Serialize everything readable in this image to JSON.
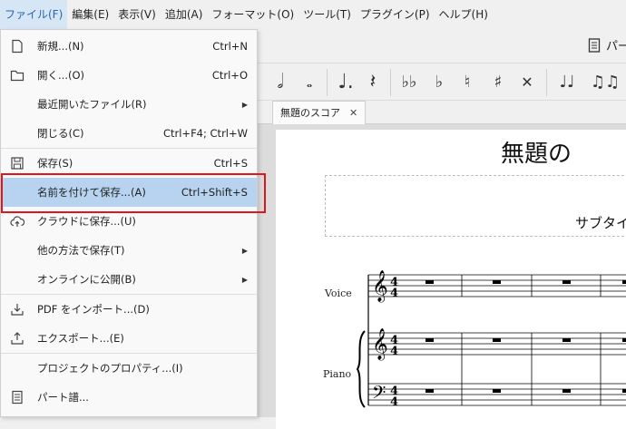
{
  "menubar": {
    "items": [
      "ファイル(F)",
      "編集(E)",
      "表示(V)",
      "追加(A)",
      "フォーマット(O)",
      "ツール(T)",
      "プラグイン(P)",
      "ヘルプ(H)"
    ]
  },
  "toolbar": {
    "parts_label": "パー"
  },
  "tab": {
    "label": "無題のスコア",
    "close": "✕"
  },
  "score": {
    "title": "無題の",
    "subtitle": "サブタイ",
    "instruments": [
      "Voice",
      "Piano"
    ]
  },
  "file_menu": {
    "items": [
      {
        "label": "新規...(N)",
        "shortcut": "Ctrl+N",
        "icon": "new-file-icon"
      },
      {
        "label": "開く...(O)",
        "shortcut": "Ctrl+O",
        "icon": "folder-icon"
      },
      {
        "label": "最近開いたファイル(R)",
        "submenu": true
      },
      {
        "label": "閉じる(C)",
        "shortcut": "Ctrl+F4; Ctrl+W"
      },
      {
        "label": "保存(S)",
        "shortcut": "Ctrl+S",
        "icon": "save-icon"
      },
      {
        "label": "名前を付けて保存...(A)",
        "shortcut": "Ctrl+Shift+S",
        "selected": true
      },
      {
        "label": "クラウドに保存...(U)",
        "icon": "cloud-upload-icon"
      },
      {
        "label": "他の方法で保存(T)",
        "submenu": true
      },
      {
        "label": "オンラインに公開(B)",
        "submenu": true
      },
      {
        "label": "PDF をインポート...(D)",
        "icon": "import-icon"
      },
      {
        "label": "エクスポート...(E)",
        "icon": "export-icon"
      },
      {
        "label": "プロジェクトのプロパティ...(I)"
      },
      {
        "label": "パート譜...",
        "icon": "parts-icon"
      }
    ]
  },
  "colors": {
    "accent": "#2766b3",
    "selected_bg": "#b7d3ef",
    "highlight_border": "#e0161b"
  }
}
